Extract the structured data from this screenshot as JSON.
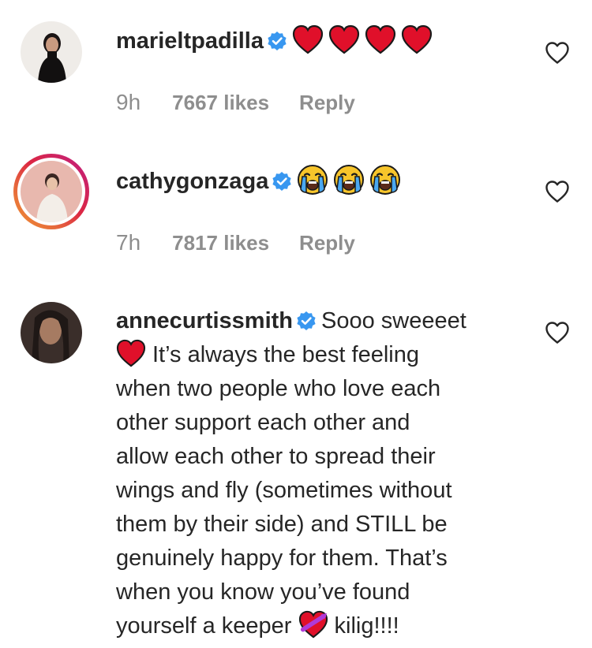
{
  "comments": [
    {
      "username": "marieltpadilla",
      "verified": true,
      "emoji_icons": [
        "red-heart-icon",
        "red-heart-icon",
        "red-heart-icon",
        "red-heart-icon"
      ],
      "text": "",
      "time": "9h",
      "likes": "7667 likes",
      "reply_label": "Reply",
      "has_story_ring": false
    },
    {
      "username": "cathygonzaga",
      "verified": true,
      "emoji_icons": [
        "loudly-crying-face-icon",
        "loudly-crying-face-icon",
        "loudly-crying-face-icon"
      ],
      "text": "",
      "time": "7h",
      "likes": "7817 likes",
      "reply_label": "Reply",
      "has_story_ring": true
    },
    {
      "username": "annecurtissmith",
      "verified": true,
      "text_lines": [
        "Sooo sweeeet",
        "It’s always the best feeling",
        "when two people who love each",
        "other support each other and",
        "allow each other to spread their",
        "wings and fly (sometimes without",
        "them by their side) and STILL be",
        "genuinely happy for them. That’s",
        "when you know you’ve found",
        "yourself a keeper",
        "kilig!!!!"
      ],
      "emoji_icons": [
        "red-heart-icon",
        "heart-with-ribbon-icon"
      ],
      "has_story_ring": false
    }
  ],
  "colors": {
    "verified_blue": "#3897f0",
    "meta_gray": "#8e8e8e",
    "text": "#262626",
    "heart_red": "#e0102a"
  }
}
